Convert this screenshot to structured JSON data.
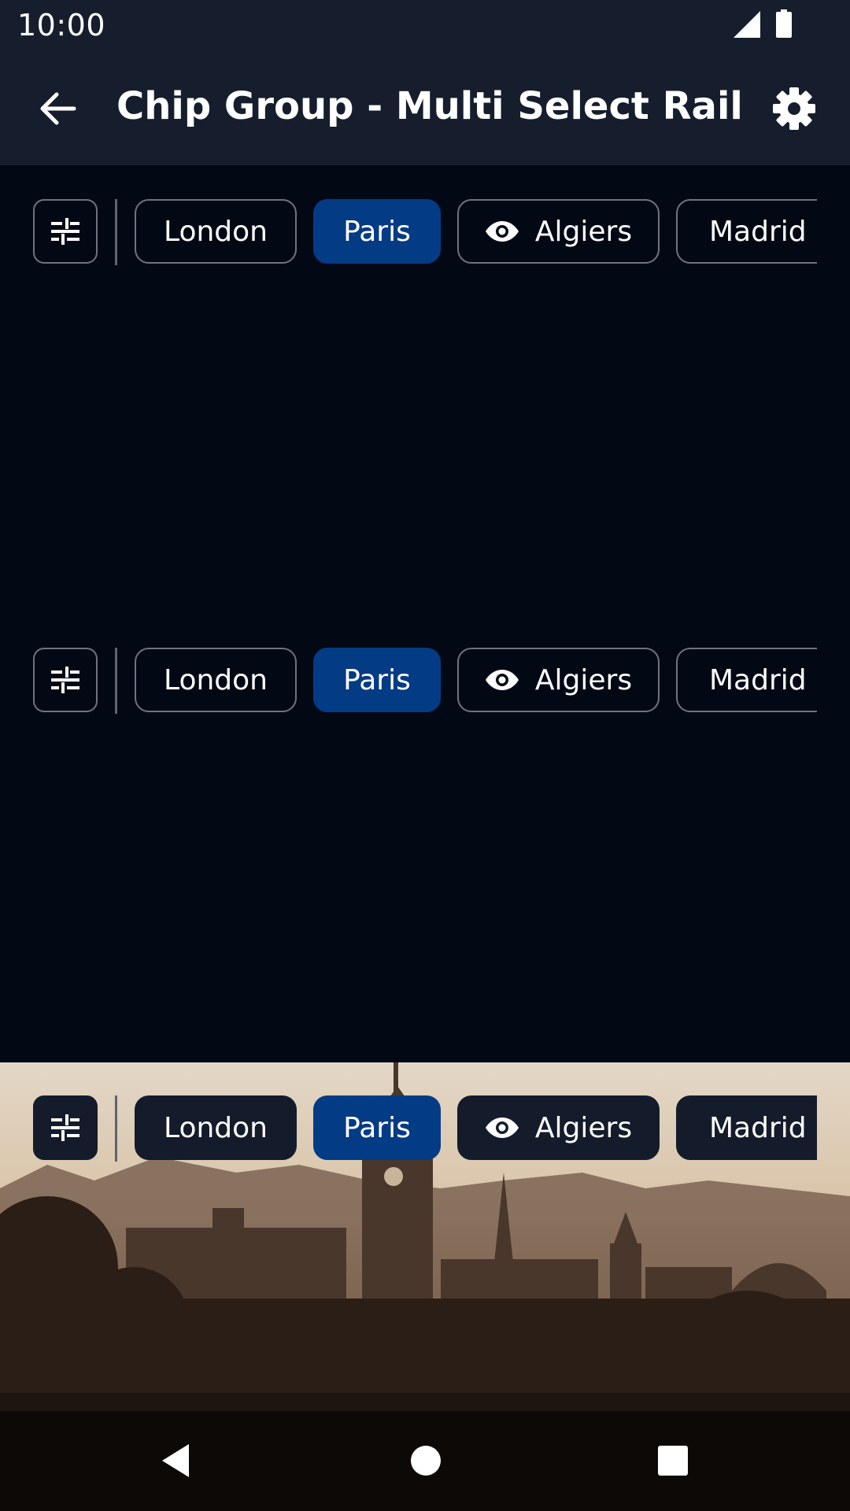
{
  "status_bar": {
    "time": "10:00",
    "icons": [
      "signal-icon",
      "battery-icon"
    ]
  },
  "app_bar": {
    "title": "Chip Group - Multi Select Rail",
    "back_icon": "arrow-left-icon",
    "settings_icon": "gear-icon"
  },
  "rails": [
    {
      "variant": "outlined",
      "filter_icon": "sliders-icon",
      "chips": [
        {
          "label": "London",
          "selected": false
        },
        {
          "label": "Paris",
          "selected": true
        },
        {
          "label": "Algiers",
          "selected": false,
          "icon": "eye-icon"
        },
        {
          "label": "Madrid",
          "selected": false
        }
      ]
    },
    {
      "variant": "outlined",
      "filter_icon": "sliders-icon",
      "chips": [
        {
          "label": "London",
          "selected": false
        },
        {
          "label": "Paris",
          "selected": true
        },
        {
          "label": "Algiers",
          "selected": false,
          "icon": "eye-icon"
        },
        {
          "label": "Madrid",
          "selected": false
        }
      ]
    },
    {
      "variant": "filled-on-image",
      "filter_icon": "sliders-icon",
      "chips": [
        {
          "label": "London",
          "selected": false
        },
        {
          "label": "Paris",
          "selected": true
        },
        {
          "label": "Algiers",
          "selected": false,
          "icon": "eye-icon"
        },
        {
          "label": "Madrid",
          "selected": false
        }
      ]
    }
  ],
  "colors": {
    "background": "#020915",
    "app_bar": "#161e2d",
    "chip_selected": "#043b85",
    "chip_outline": "#6d7380",
    "chip_filled": "#141c2c"
  },
  "navigation_bar": {
    "icons": [
      "nav-back-icon",
      "nav-home-icon",
      "nav-recents-icon"
    ]
  }
}
